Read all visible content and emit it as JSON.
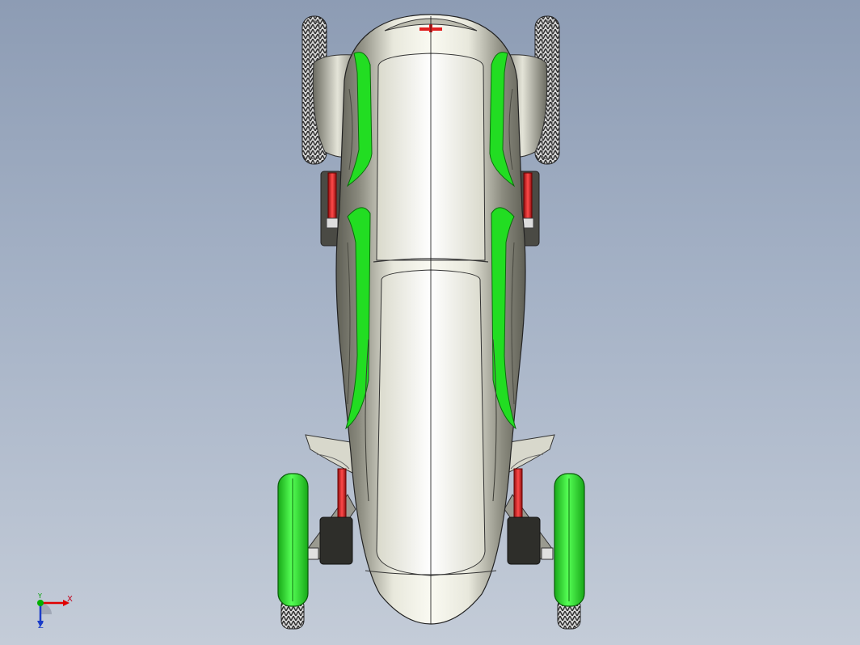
{
  "viewport": {
    "background_top": "#8d9cb4",
    "background_bottom": "#c4ccd8"
  },
  "model": {
    "body_color": "#f2f2e8",
    "body_shade": "#6e6e62",
    "accent_color": "#22dd22",
    "shock_color": "#e02020",
    "tire_color": "#3a3a3a"
  },
  "triad": {
    "x_label": "X",
    "y_label": "Y",
    "z_label": "Z",
    "x_color": "#e00000",
    "y_color": "#00b000",
    "z_color": "#1a3cc8"
  }
}
